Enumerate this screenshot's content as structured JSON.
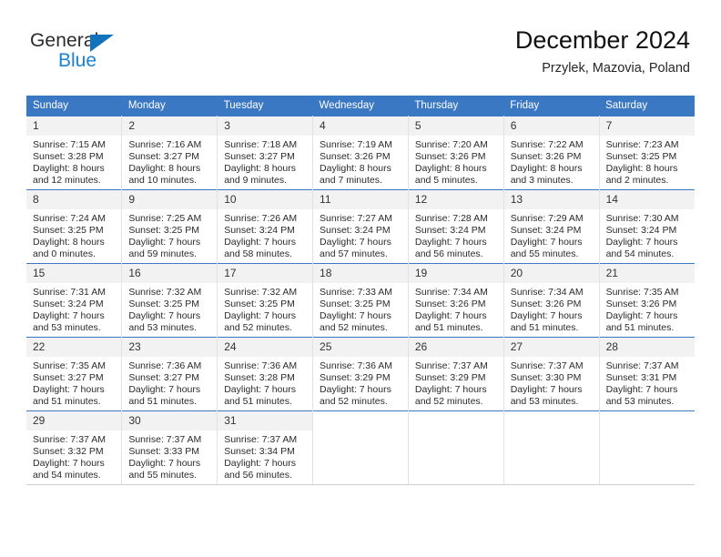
{
  "brand": {
    "word_one": "General",
    "word_two": "Blue",
    "triangle_color": "#1273bd",
    "blue_text_color": "#1b81d6"
  },
  "header": {
    "title": "December 2024",
    "subtitle": "Przylek, Mazovia, Poland"
  },
  "theme": {
    "header_row_bg": "#3b78c3",
    "header_row_text": "#ffffff",
    "daynum_bg": "#f2f2f2",
    "cell_border": "#e2e2e2",
    "week_separator": "#3b78c3"
  },
  "weekday_headers": [
    "Sunday",
    "Monday",
    "Tuesday",
    "Wednesday",
    "Thursday",
    "Friday",
    "Saturday"
  ],
  "labels": {
    "sunrise_prefix": "Sunrise:",
    "sunset_prefix": "Sunset:",
    "daylight_prefix": "Daylight:"
  },
  "weeks": [
    [
      {
        "day": "1",
        "l1": "Sunrise: 7:15 AM",
        "l2": "Sunset: 3:28 PM",
        "l3": "Daylight: 8 hours",
        "l4": "and 12 minutes."
      },
      {
        "day": "2",
        "l1": "Sunrise: 7:16 AM",
        "l2": "Sunset: 3:27 PM",
        "l3": "Daylight: 8 hours",
        "l4": "and 10 minutes."
      },
      {
        "day": "3",
        "l1": "Sunrise: 7:18 AM",
        "l2": "Sunset: 3:27 PM",
        "l3": "Daylight: 8 hours",
        "l4": "and 9 minutes."
      },
      {
        "day": "4",
        "l1": "Sunrise: 7:19 AM",
        "l2": "Sunset: 3:26 PM",
        "l3": "Daylight: 8 hours",
        "l4": "and 7 minutes."
      },
      {
        "day": "5",
        "l1": "Sunrise: 7:20 AM",
        "l2": "Sunset: 3:26 PM",
        "l3": "Daylight: 8 hours",
        "l4": "and 5 minutes."
      },
      {
        "day": "6",
        "l1": "Sunrise: 7:22 AM",
        "l2": "Sunset: 3:26 PM",
        "l3": "Daylight: 8 hours",
        "l4": "and 3 minutes."
      },
      {
        "day": "7",
        "l1": "Sunrise: 7:23 AM",
        "l2": "Sunset: 3:25 PM",
        "l3": "Daylight: 8 hours",
        "l4": "and 2 minutes."
      }
    ],
    [
      {
        "day": "8",
        "l1": "Sunrise: 7:24 AM",
        "l2": "Sunset: 3:25 PM",
        "l3": "Daylight: 8 hours",
        "l4": "and 0 minutes."
      },
      {
        "day": "9",
        "l1": "Sunrise: 7:25 AM",
        "l2": "Sunset: 3:25 PM",
        "l3": "Daylight: 7 hours",
        "l4": "and 59 minutes."
      },
      {
        "day": "10",
        "l1": "Sunrise: 7:26 AM",
        "l2": "Sunset: 3:24 PM",
        "l3": "Daylight: 7 hours",
        "l4": "and 58 minutes."
      },
      {
        "day": "11",
        "l1": "Sunrise: 7:27 AM",
        "l2": "Sunset: 3:24 PM",
        "l3": "Daylight: 7 hours",
        "l4": "and 57 minutes."
      },
      {
        "day": "12",
        "l1": "Sunrise: 7:28 AM",
        "l2": "Sunset: 3:24 PM",
        "l3": "Daylight: 7 hours",
        "l4": "and 56 minutes."
      },
      {
        "day": "13",
        "l1": "Sunrise: 7:29 AM",
        "l2": "Sunset: 3:24 PM",
        "l3": "Daylight: 7 hours",
        "l4": "and 55 minutes."
      },
      {
        "day": "14",
        "l1": "Sunrise: 7:30 AM",
        "l2": "Sunset: 3:24 PM",
        "l3": "Daylight: 7 hours",
        "l4": "and 54 minutes."
      }
    ],
    [
      {
        "day": "15",
        "l1": "Sunrise: 7:31 AM",
        "l2": "Sunset: 3:24 PM",
        "l3": "Daylight: 7 hours",
        "l4": "and 53 minutes."
      },
      {
        "day": "16",
        "l1": "Sunrise: 7:32 AM",
        "l2": "Sunset: 3:25 PM",
        "l3": "Daylight: 7 hours",
        "l4": "and 53 minutes."
      },
      {
        "day": "17",
        "l1": "Sunrise: 7:32 AM",
        "l2": "Sunset: 3:25 PM",
        "l3": "Daylight: 7 hours",
        "l4": "and 52 minutes."
      },
      {
        "day": "18",
        "l1": "Sunrise: 7:33 AM",
        "l2": "Sunset: 3:25 PM",
        "l3": "Daylight: 7 hours",
        "l4": "and 52 minutes."
      },
      {
        "day": "19",
        "l1": "Sunrise: 7:34 AM",
        "l2": "Sunset: 3:26 PM",
        "l3": "Daylight: 7 hours",
        "l4": "and 51 minutes."
      },
      {
        "day": "20",
        "l1": "Sunrise: 7:34 AM",
        "l2": "Sunset: 3:26 PM",
        "l3": "Daylight: 7 hours",
        "l4": "and 51 minutes."
      },
      {
        "day": "21",
        "l1": "Sunrise: 7:35 AM",
        "l2": "Sunset: 3:26 PM",
        "l3": "Daylight: 7 hours",
        "l4": "and 51 minutes."
      }
    ],
    [
      {
        "day": "22",
        "l1": "Sunrise: 7:35 AM",
        "l2": "Sunset: 3:27 PM",
        "l3": "Daylight: 7 hours",
        "l4": "and 51 minutes."
      },
      {
        "day": "23",
        "l1": "Sunrise: 7:36 AM",
        "l2": "Sunset: 3:27 PM",
        "l3": "Daylight: 7 hours",
        "l4": "and 51 minutes."
      },
      {
        "day": "24",
        "l1": "Sunrise: 7:36 AM",
        "l2": "Sunset: 3:28 PM",
        "l3": "Daylight: 7 hours",
        "l4": "and 51 minutes."
      },
      {
        "day": "25",
        "l1": "Sunrise: 7:36 AM",
        "l2": "Sunset: 3:29 PM",
        "l3": "Daylight: 7 hours",
        "l4": "and 52 minutes."
      },
      {
        "day": "26",
        "l1": "Sunrise: 7:37 AM",
        "l2": "Sunset: 3:29 PM",
        "l3": "Daylight: 7 hours",
        "l4": "and 52 minutes."
      },
      {
        "day": "27",
        "l1": "Sunrise: 7:37 AM",
        "l2": "Sunset: 3:30 PM",
        "l3": "Daylight: 7 hours",
        "l4": "and 53 minutes."
      },
      {
        "day": "28",
        "l1": "Sunrise: 7:37 AM",
        "l2": "Sunset: 3:31 PM",
        "l3": "Daylight: 7 hours",
        "l4": "and 53 minutes."
      }
    ],
    [
      {
        "day": "29",
        "l1": "Sunrise: 7:37 AM",
        "l2": "Sunset: 3:32 PM",
        "l3": "Daylight: 7 hours",
        "l4": "and 54 minutes."
      },
      {
        "day": "30",
        "l1": "Sunrise: 7:37 AM",
        "l2": "Sunset: 3:33 PM",
        "l3": "Daylight: 7 hours",
        "l4": "and 55 minutes."
      },
      {
        "day": "31",
        "l1": "Sunrise: 7:37 AM",
        "l2": "Sunset: 3:34 PM",
        "l3": "Daylight: 7 hours",
        "l4": "and 56 minutes."
      },
      {
        "day": "",
        "l1": "",
        "l2": "",
        "l3": "",
        "l4": ""
      },
      {
        "day": "",
        "l1": "",
        "l2": "",
        "l3": "",
        "l4": ""
      },
      {
        "day": "",
        "l1": "",
        "l2": "",
        "l3": "",
        "l4": ""
      },
      {
        "day": "",
        "l1": "",
        "l2": "",
        "l3": "",
        "l4": ""
      }
    ]
  ]
}
